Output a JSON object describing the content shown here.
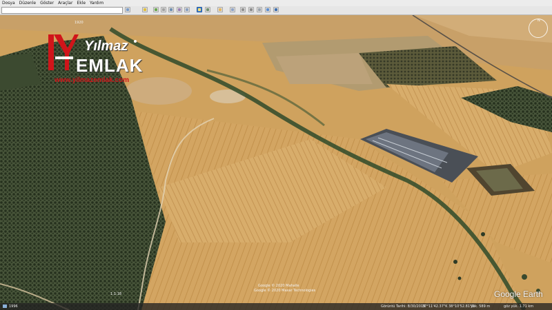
{
  "menu": {
    "items": [
      "Dosya",
      "Düzenle",
      "Göster",
      "Araçlar",
      "Ekle",
      "Yardım"
    ]
  },
  "toolbar": {
    "buttons": [
      "sidebar-toggle-icon",
      "placemark-icon",
      "polygon-icon",
      "path-icon",
      "overlay-icon",
      "tour-icon",
      "history-icon",
      "sun-icon",
      "planets-icon",
      "ruler-icon",
      "email-icon",
      "print-icon",
      "save-image-icon",
      "maps-icon"
    ]
  },
  "map": {
    "top_label": "1920",
    "center_label_1": "Google © 2020 Mahalle",
    "center_label_2": "Google © 2020 Maxar Technologies",
    "left_label": "1:1:18"
  },
  "logo": {
    "line1": "Yılmaz",
    "line2": "EMLAK",
    "url": "www.yilmazemlak.com"
  },
  "compass": {
    "north": "N"
  },
  "status": {
    "tour": "1996",
    "imagery": "Görüntü Tarihi: 8/30/2019",
    "coords": "37°11'42.37\"K  38°10'52.81\"D",
    "elev": "yük. 589 m",
    "eye": "göz yük. 1.71 km"
  },
  "brand": {
    "product": "Google Earth"
  },
  "colors": {
    "logo_red": "#d0151a",
    "field": "#cfa25e",
    "olive": "#35432a"
  }
}
